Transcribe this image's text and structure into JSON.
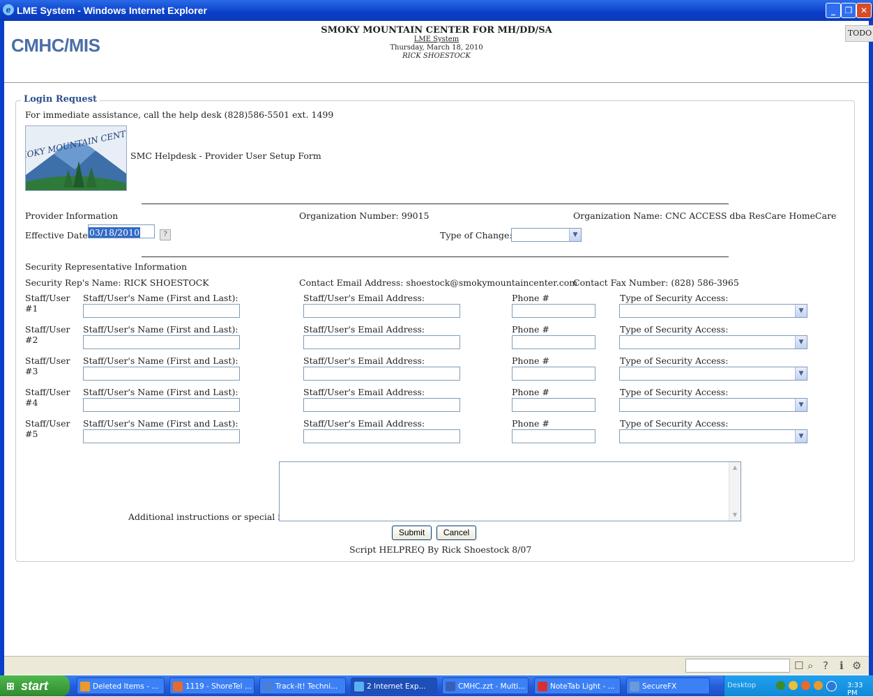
{
  "window": {
    "title": "LME System - Windows Internet Explorer",
    "min_glyph": "_",
    "max_glyph": "❐",
    "close_glyph": "✕"
  },
  "header": {
    "app_logo": "CMHC/MIS",
    "org_name": "SMOKY MOUNTAIN CENTER FOR MH/DD/SA",
    "system_link": "LME System",
    "date": "Thursday, March 18, 2010",
    "user": "RICK SHOESTOCK",
    "todo_label": "TODO"
  },
  "form": {
    "legend": "Login Request",
    "assist_text": "For immediate assistance, call the help desk (828)586-5501 ext. 1499",
    "logo_text": "SMOKY MOUNTAIN CENTER",
    "form_title": "SMC Helpdesk - Provider User Setup Form",
    "provider": {
      "section_label": "Provider Information",
      "org_number": "Organization Number: 99015",
      "org_name": "Organization Name: CNC ACCESS dba ResCare HomeCare",
      "effective_date_label": "Effective Date:",
      "effective_date_value": "03/18/2010",
      "help_button": "?",
      "type_of_change_label": "Type of Change:",
      "type_of_change_value": ""
    },
    "security": {
      "section_label": "Security Representative Information",
      "rep_name": "Security Rep's Name: RICK SHOESTOCK",
      "contact_email": "Contact Email Address: shoestock@smokymountaincenter.com",
      "contact_fax": "Contact Fax Number: (828) 586-3965"
    },
    "users": [
      {
        "label": "Staff/User",
        "num": "#1"
      },
      {
        "label": "Staff/User",
        "num": "#2"
      },
      {
        "label": "Staff/User",
        "num": "#3"
      },
      {
        "label": "Staff/User",
        "num": "#4"
      },
      {
        "label": "Staff/User",
        "num": "#5"
      }
    ],
    "user_fields": {
      "name_label": "Staff/User's Name (First and Last):",
      "email_label": "Staff/User's Email Address:",
      "phone_label": "Phone #",
      "access_label": "Type of Security Access:"
    },
    "additional_label": "Additional instructions or special info:",
    "submit_label": "Submit",
    "cancel_label": "Cancel",
    "footer_text": "Script HELPREQ By Rick Shoestock 8/07"
  },
  "taskbar": {
    "start_label": "start",
    "items": [
      {
        "label": "Deleted Items - ...",
        "color": "#e89a2c"
      },
      {
        "label": "1119 - ShoreTel ...",
        "color": "#e86a2c"
      },
      {
        "label": "Track-It! Techni...",
        "color": "#4a7fd6"
      },
      {
        "label": "2 Internet Exp...",
        "color": "#5ab0f0"
      },
      {
        "label": "CMHC.zzt - Multi...",
        "color": "#3a5fb8"
      },
      {
        "label": "NoteTab Light - ...",
        "color": "#d83030"
      },
      {
        "label": "SecureFX",
        "color": "#6a9ad8"
      }
    ],
    "desktop_label": "Desktop",
    "clock": "3:33 PM"
  }
}
